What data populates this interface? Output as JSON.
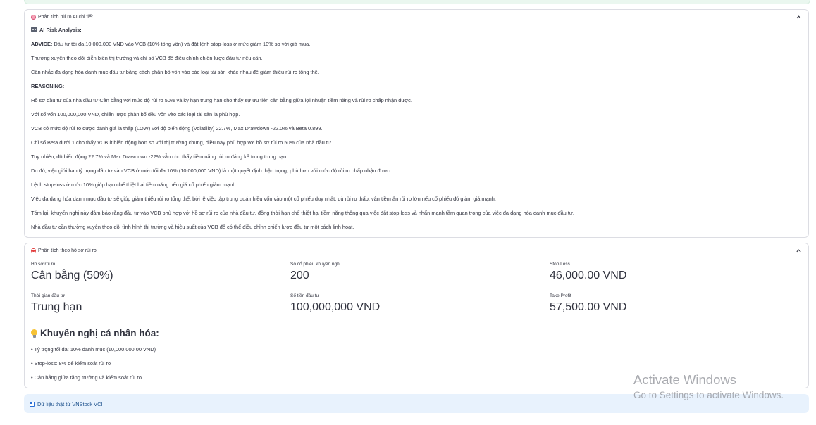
{
  "analysis": {
    "title": "Phân tích rủi ro AI chi tiết",
    "heading": "AI Risk Analysis:",
    "advice_label": "ADVICE:",
    "advice_text": " Đầu tư tối đa 10,000,000 VND vào VCB (10% tổng vốn) và đặt lệnh stop-loss ở mức giảm 10% so với giá mua.",
    "advice_lines": [
      "Thường xuyên theo dõi diễn biến thị trường và chỉ số VCB để điều chỉnh chiến lược đầu tư nếu cần.",
      "Cân nhắc đa dạng hóa danh mục đầu tư bằng cách phân bổ vốn vào các loại tài sản khác nhau để giảm thiểu rủi ro tổng thể."
    ],
    "reasoning_label": "REASONING:",
    "reasoning_lines": [
      "Hồ sơ đầu tư của nhà đầu tư Cân bằng với mức độ rủi ro 50% và kỳ hạn trung hạn cho thấy sự ưu tiên cân bằng giữa lợi nhuận tiềm năng và rủi ro chấp nhận được.",
      "Với số vốn 100,000,000 VND, chiến lược phân bổ đều vốn vào các loại tài sản là phù hợp.",
      "VCB có mức độ rủi ro được đánh giá là thấp (LOW) với độ biến động (Volatility) 22.7%, Max Drawdown -22.0% và Beta 0.899.",
      "Chỉ số Beta dưới 1 cho thấy VCB ít biến động hơn so với thị trường chung, điều này phù hợp với hồ sơ rủi ro 50% của nhà đầu tư.",
      "Tuy nhiên, độ biến động 22.7% và Max Drawdown -22% vẫn cho thấy tiềm năng rủi ro đáng kể trong trung hạn.",
      "Do đó, việc giới hạn tỷ trọng đầu tư vào VCB ở mức tối đa 10% (10,000,000 VND) là một quyết định thận trọng, phù hợp với mức độ rủi ro chấp nhận được.",
      "Lệnh stop-loss ở mức 10% giúp hạn chế thiệt hại tiềm năng nếu giá cổ phiếu giảm mạnh.",
      "Việc đa dạng hóa danh mục đầu tư sẽ giúp giảm thiểu rủi ro tổng thể, bởi lẽ việc tập trung quá nhiều vốn vào một cổ phiếu duy nhất, dù rủi ro thấp, vẫn tiềm ẩn rủi ro lớn nếu cổ phiếu đó giảm giá mạnh.",
      "Tóm lại, khuyến nghị này đảm bảo rằng đầu tư vào VCB phù hợp với hồ sơ rủi ro của nhà đầu tư, đồng thời hạn chế thiệt hại tiềm năng thông qua việc đặt stop-loss và nhấn mạnh tầm quan trọng của việc đa dạng hóa danh mục đầu tư.",
      "Nhà đầu tư cần thường xuyên theo dõi tình hình thị trường và hiệu suất của VCB để có thể điều chỉnh chiến lược đầu tư một cách linh hoạt."
    ]
  },
  "profile": {
    "title": "Phân tích theo hồ sơ rủi ro",
    "metrics": [
      {
        "label": "Hồ sơ rủi ro",
        "value": "Cân bằng (50%)"
      },
      {
        "label": "Số cổ phiếu khuyến nghị",
        "value": "200"
      },
      {
        "label": "Stop Loss",
        "value": "46,000.00 VND"
      },
      {
        "label": "Thời gian đầu tư",
        "value": "Trung hạn"
      },
      {
        "label": "Số tiền đầu tư",
        "value": "100,000,000 VND"
      },
      {
        "label": "Take Profit",
        "value": "57,500.00 VND"
      }
    ],
    "rec_title": "Khuyến nghị cá nhân hóa:",
    "bullets": [
      "• Tỷ trọng tối đa: 10% danh mục (10,000,000.00 VND)",
      "• Stop-loss: 8% để kiểm soát rủi ro",
      "• Cân bằng giữa tăng trưởng và kiểm soát rủi ro"
    ]
  },
  "source_note": "Dữ liệu thật từ VNStock VCI",
  "watermark": {
    "line1": "Activate Windows",
    "line2": "Go to Settings to activate Windows."
  },
  "icons": [
    "brain-icon",
    "robot-icon",
    "target-icon",
    "lightbulb-icon",
    "bar-chart-icon",
    "chevron-up-icon"
  ]
}
